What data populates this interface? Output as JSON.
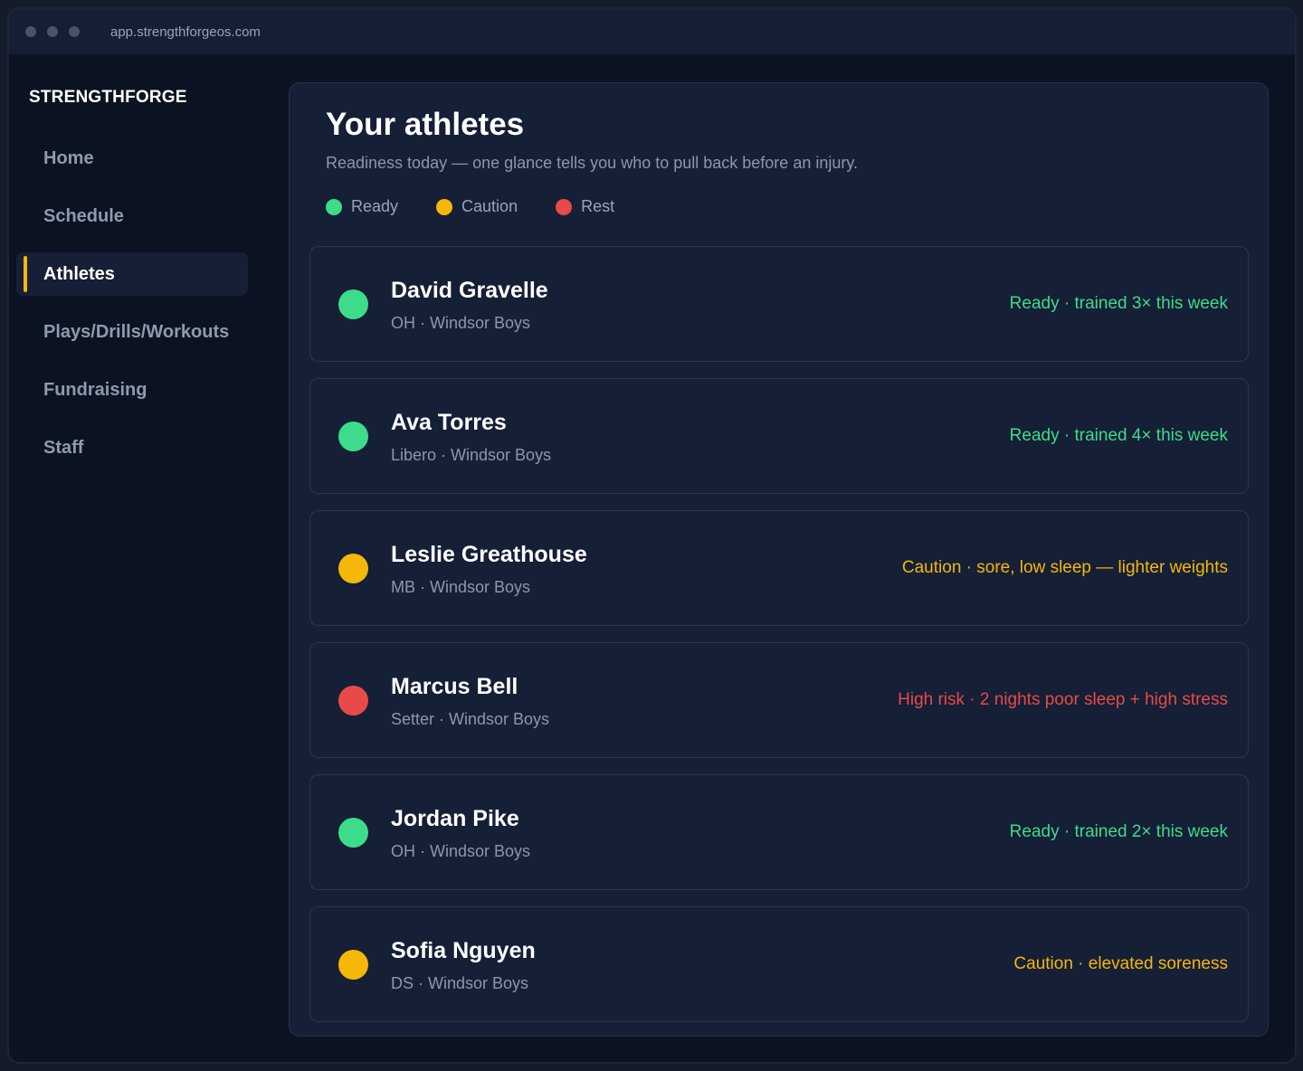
{
  "browser": {
    "url": "app.strengthforgeos.com"
  },
  "sidebar": {
    "brand": "STRENGTHFORGE",
    "items": [
      {
        "label": "Home",
        "active": false
      },
      {
        "label": "Schedule",
        "active": false
      },
      {
        "label": "Athletes",
        "active": true
      },
      {
        "label": "Plays/Drills/Workouts",
        "active": false
      },
      {
        "label": "Fundraising",
        "active": false
      },
      {
        "label": "Staff",
        "active": false
      }
    ]
  },
  "main": {
    "title": "Your athletes",
    "subtitle": "Readiness today — one glance tells you who to pull back before an injury.",
    "legend": [
      {
        "label": "Ready",
        "color": "#3ddc8a"
      },
      {
        "label": "Caution",
        "color": "#f5b70a"
      },
      {
        "label": "Rest",
        "color": "#e84a4a"
      }
    ],
    "athletes": [
      {
        "name": "David Gravelle",
        "meta": "OH · Windsor Boys",
        "status": "ready",
        "status_text": "Ready · trained 3× this week"
      },
      {
        "name": "Ava Torres",
        "meta": "Libero · Windsor Boys",
        "status": "ready",
        "status_text": "Ready · trained 4× this week"
      },
      {
        "name": "Leslie Greathouse",
        "meta": "MB · Windsor Boys",
        "status": "caution",
        "status_text": "Caution · sore, low sleep — lighter weights"
      },
      {
        "name": "Marcus Bell",
        "meta": "Setter · Windsor Boys",
        "status": "rest",
        "status_text": "High risk · 2 nights poor sleep + high stress"
      },
      {
        "name": "Jordan Pike",
        "meta": "OH · Windsor Boys",
        "status": "ready",
        "status_text": "Ready · trained 2× this week"
      },
      {
        "name": "Sofia Nguyen",
        "meta": "DS · Windsor Boys",
        "status": "caution",
        "status_text": "Caution · elevated soreness"
      }
    ]
  },
  "colors": {
    "ready": "#3ddc8a",
    "caution": "#f5b70a",
    "rest": "#e84a4a",
    "accent": "#f5b70a"
  }
}
